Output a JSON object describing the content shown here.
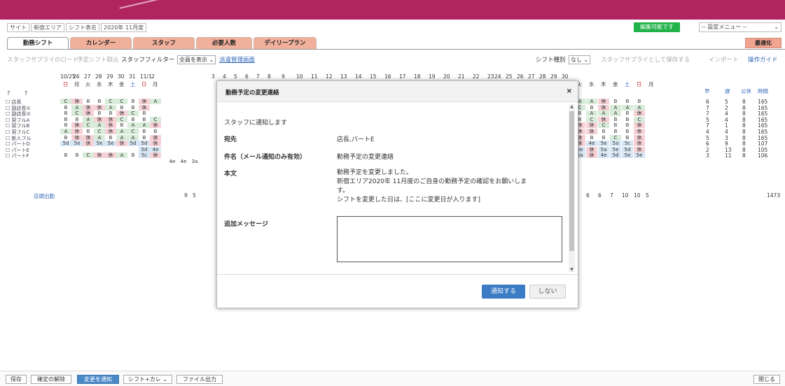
{
  "info_bar": {
    "site_label": "サイト",
    "site_value": "新宿エリア",
    "shift_label": "シフト表名",
    "shift_value": "2020年 11月度"
  },
  "status_badge": "編集可能です",
  "settings_menu": "-- 設定メニュー --",
  "tabs": [
    {
      "label": "勤務シフト",
      "active": true
    },
    {
      "label": "カレンダー"
    },
    {
      "label": "スタッフ"
    },
    {
      "label": "必要人数"
    },
    {
      "label": "デイリープラン"
    }
  ],
  "optimize_button": "最適化",
  "toolbar": {
    "load_supply": "スタッフサプライのロード",
    "load_planned": "予定シフト取込",
    "staff_filter_label": "スタッフフィルター",
    "staff_filter_value": "全員を表示",
    "dispatch_link": "派遣管理画面",
    "shift_type_label": "シフト種別",
    "shift_type_value": "なし",
    "save_supply": "スタッフサプライとして保存する",
    "import": "インポート",
    "guide": "操作ガイド"
  },
  "grid": {
    "corner_left": "?",
    "corner_right": "?",
    "dates_left": [
      "10/25",
      "26",
      "27",
      "28",
      "29",
      "30",
      "31",
      "11/1",
      "2"
    ],
    "weekdays_left": [
      "日",
      "月",
      "火",
      "水",
      "木",
      "金",
      "土",
      "日",
      "月"
    ],
    "dates_mid": [
      "3",
      "4",
      "5",
      "6",
      "7",
      "8",
      "9",
      "10",
      "11",
      "12",
      "13",
      "14",
      "15",
      "16",
      "17",
      "18",
      "19",
      "20",
      "21",
      "22",
      "23",
      "24",
      "25",
      "26",
      "27",
      "28",
      "29",
      "30"
    ],
    "weekdays_right": [
      "火",
      "水",
      "木",
      "金",
      "土",
      "日",
      "月"
    ],
    "summary_headers": [
      "早",
      "遅",
      "公休",
      "時間"
    ],
    "staff": [
      {
        "name": "店長",
        "left": [
          "C",
          "休",
          "B",
          "B",
          "C",
          "C",
          "B",
          "休",
          "A"
        ],
        "right": [
          "A",
          "A",
          "休",
          "B",
          "B",
          "B"
        ],
        "summary": [
          "6",
          "5",
          "8",
          "165"
        ]
      },
      {
        "name": "副店長①",
        "left": [
          "B",
          "A",
          "休",
          "休",
          "A",
          "B",
          "B",
          "休"
        ],
        "right": [
          "C",
          "B",
          "休",
          "A",
          "A",
          "A"
        ],
        "summary": [
          "7",
          "2",
          "8",
          "165"
        ]
      },
      {
        "name": "副店長②",
        "left": [
          "B",
          "C",
          "休",
          "B",
          "B",
          "休",
          "C",
          "B"
        ],
        "right": [
          "B",
          "A",
          "A",
          "A",
          "B",
          "休"
        ],
        "summary": [
          "7",
          "4",
          "8",
          "165"
        ]
      },
      {
        "name": "契フルA",
        "left": [
          "B",
          "B",
          "A",
          "休",
          "休",
          "C",
          "B",
          "B",
          "C"
        ],
        "right": [
          "B",
          "C",
          "休",
          "B",
          "B",
          "C"
        ],
        "summary": [
          "5",
          "4",
          "8",
          "165"
        ]
      },
      {
        "name": "契フルB",
        "left": [
          "B",
          "休",
          "C",
          "A",
          "休",
          "B",
          "A",
          "A",
          "休"
        ],
        "right": [
          "休",
          "休",
          "C",
          "B",
          "B",
          "休"
        ],
        "summary": [
          "7",
          "1",
          "8",
          "165"
        ]
      },
      {
        "name": "契フルC",
        "left": [
          "A",
          "休",
          "B",
          "C",
          "休",
          "A",
          "C",
          "B",
          "B"
        ],
        "right": [
          "休",
          "休",
          "B",
          "B",
          "B",
          "休"
        ],
        "summary": [
          "4",
          "4",
          "8",
          "165"
        ]
      },
      {
        "name": "新人フル",
        "left": [
          "B",
          "休",
          "休",
          "A",
          "B",
          "A",
          "A",
          "B",
          "休"
        ],
        "right": [
          "休",
          "B",
          "B",
          "C",
          "B",
          "休"
        ],
        "summary": [
          "5",
          "3",
          "8",
          "165"
        ]
      },
      {
        "name": "パートD",
        "left": [
          "5d",
          "5e",
          "休",
          "5e",
          "5e",
          "休",
          "5d",
          "5d",
          "休"
        ],
        "right": [
          "休",
          "4e",
          "5e",
          "5a",
          "5c",
          "休"
        ],
        "summary": [
          "6",
          "9",
          "8",
          "107"
        ]
      },
      {
        "name": "パートE",
        "left": [
          "",
          "",
          "",
          "",
          "",
          "",
          "",
          "5d",
          "4e"
        ],
        "right": [
          "5e",
          "休",
          "5a",
          "5e",
          "5d",
          "休"
        ],
        "summary": [
          "2",
          "13",
          "8",
          "105"
        ]
      },
      {
        "name": "パートF",
        "left": [
          "B",
          "B",
          "C",
          "休",
          "休",
          "A",
          "B",
          "5c",
          "休"
        ],
        "right": [
          "5a",
          "休",
          "4e",
          "5d",
          "5e",
          "5e"
        ],
        "summary": [
          "3",
          "11",
          "8",
          "106"
        ]
      }
    ],
    "overflow_left": [
      "4e",
      "4e",
      "3a"
    ],
    "footer_label": "店頭出勤",
    "footer_left": [
      "9",
      "5"
    ],
    "footer_right": [
      "8",
      "6",
      "6",
      "7",
      "10",
      "10",
      "5"
    ],
    "footer_total": "1473"
  },
  "modal": {
    "title": "勤務予定の変更連絡",
    "close": "×",
    "intro": "スタッフに通知します",
    "to_label": "宛先",
    "to_value": "店長,パートE",
    "subject_label": "件名（メール通知のみ有効）",
    "subject_value": "勤務予定の変更連絡",
    "body_label": "本文",
    "body_lines": [
      "勤務予定を変更しました。",
      "新宿エリア2020年 11月度のご自身の勤務予定の確認をお願いしま",
      "す。",
      "シフトを変更した日は、[ここに変更日が入ります]"
    ],
    "extra_label": "追加メッセージ",
    "notify_button": "通知する",
    "cancel_button": "しない"
  },
  "bottom_bar": {
    "save": "保存",
    "unconfirm": "確定の解除",
    "notify_changes": "変更を通知",
    "shift_select": "シフト+カレ",
    "file_output": "ファイル出力",
    "close": "閉じる"
  },
  "colors": {
    "brand": "#b0245f",
    "tab": "#f1b09c",
    "notify": "#3a7dc4",
    "status": "#21b24a"
  }
}
